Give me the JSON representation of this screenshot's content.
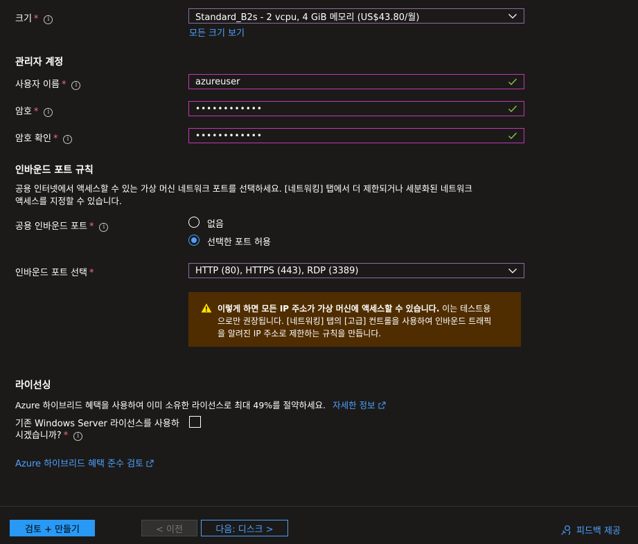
{
  "size": {
    "label": "크기",
    "value": "Standard_B2s - 2 vcpu, 4 GiB 메모리 (US$43.80/월)",
    "link": "모든 크기 보기"
  },
  "admin": {
    "heading": "관리자 계정",
    "username_label": "사용자 이름",
    "username_value": "azureuser",
    "password_label": "암호",
    "password_value": "••••••••••••",
    "confirm_label": "암호 확인",
    "confirm_value": "••••••••••••"
  },
  "inbound": {
    "heading": "인바운드 포트 규칙",
    "description_line1": "공용 인터넷에서 액세스할 수 있는 가상 머신 네트워크 포트를 선택하세요. [네트워킹] 탭에서 더 제한되거나 세분화된 네트워크",
    "description_line2": "액세스를 지정할 수 있습니다.",
    "public_ports_label": "공용 인바운드 포트",
    "options": [
      "없음",
      "선택한 포트 허용"
    ],
    "selected_option": "선택한 포트 허용",
    "select_ports_label": "인바운드 포트 선택",
    "select_ports_value": "HTTP (80), HTTPS (443), RDP (3389)"
  },
  "warning": {
    "bold": "이렇게 하면 모든 IP 주소가 가상 머신에 액세스할 수 있습니다.",
    "line1_rest": " 이는 테스트용",
    "line2": "으로만 권장됩니다. [네트워킹] 탭의 [고급] 컨트롤을 사용하여 인바운드 트래픽",
    "line3": "을 알려진 IP 주소로 제한하는 규칙을 만듭니다."
  },
  "licensing": {
    "heading": "라이선싱",
    "description": "Azure 하이브리드 혜택을 사용하여 이미 소유한 라이선스로 최대 49%를 절약하세요.",
    "learn_more": "자세한 정보",
    "existing_label_line1": "기존 Windows Server 라이선스를 사용하",
    "existing_label_line2": "시겠습니까?",
    "existing_checked": false,
    "compliance_link": "Azure 하이브리드 혜택 준수 검토"
  },
  "footer": {
    "review_create": "검토 + 만들기",
    "previous": "< 이전",
    "next": "다음: 디스크 >",
    "feedback": "피드백 제공"
  },
  "colors": {
    "background": "#1b1a19",
    "accent": "#4ea1ff",
    "primary_button": "#2899f5",
    "focus_border": "#c239b3",
    "valid_check": "#92c353",
    "warning_bg": "#4f2d00",
    "warning_icon": "#fce100",
    "required": "#f1707b"
  }
}
